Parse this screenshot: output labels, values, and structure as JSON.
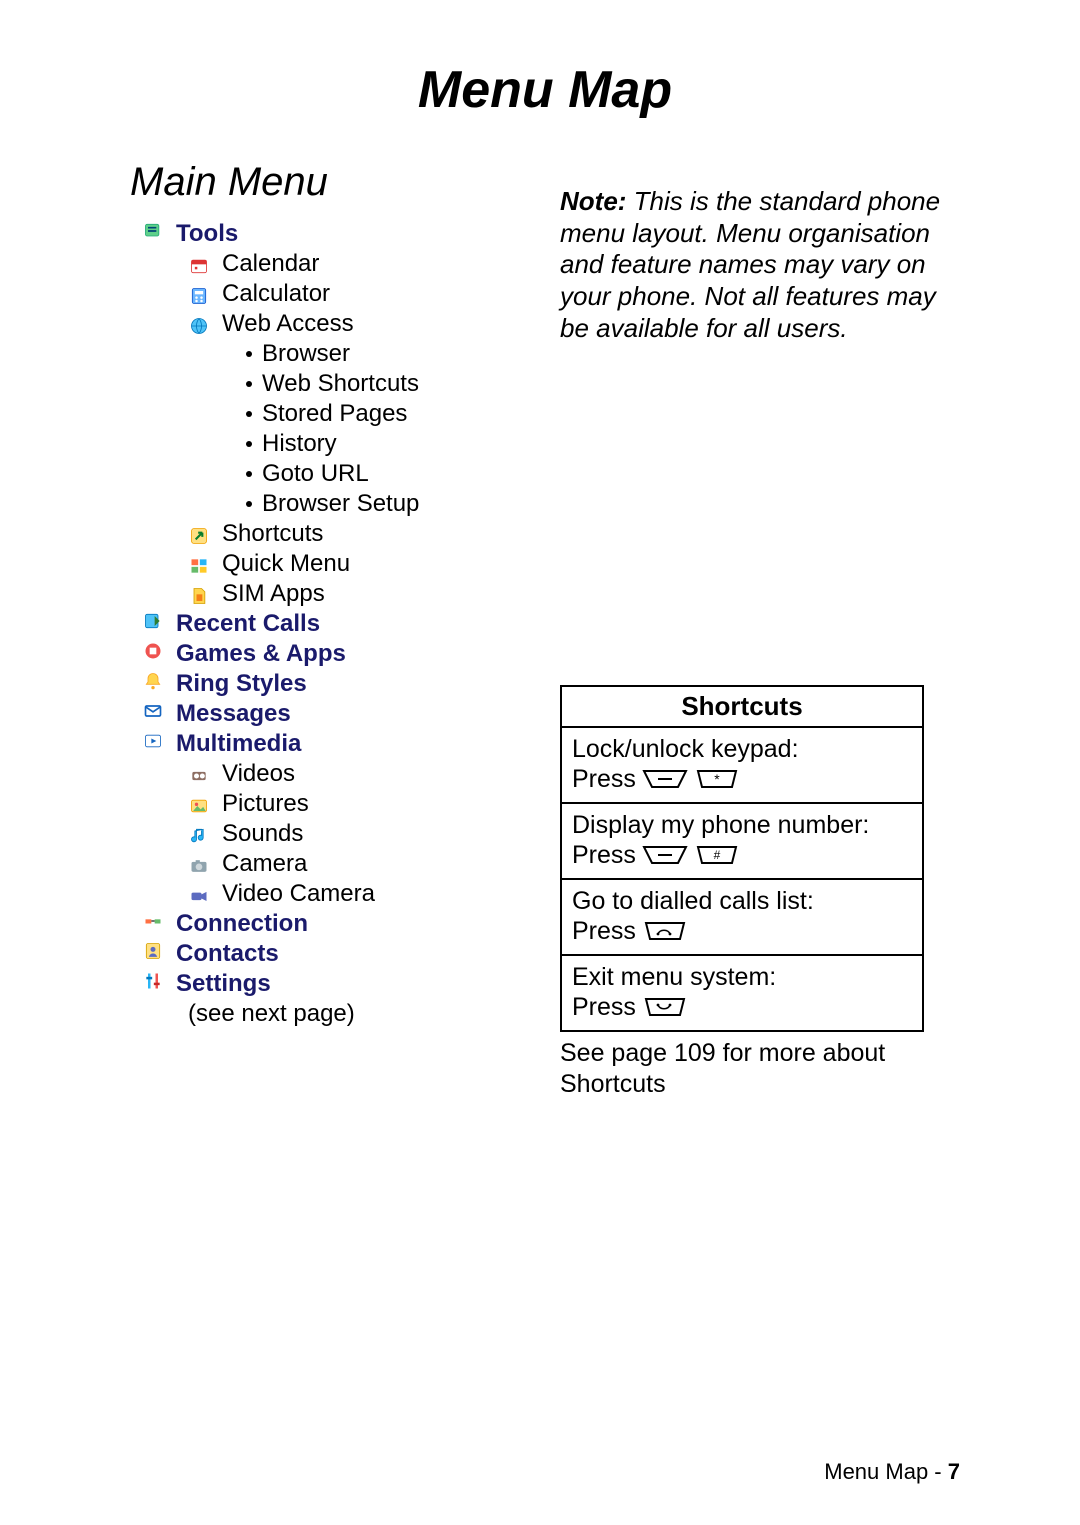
{
  "title": "Menu Map",
  "main_menu_heading": "Main Menu",
  "note": {
    "label": "Note:",
    "body": " This is the standard phone menu layout. Menu organisation and feature names may vary on your phone. Not all features may be available for all users."
  },
  "categories": [
    {
      "name": "Tools",
      "icon": "tools-icon",
      "children": [
        {
          "name": "Calendar",
          "icon": "calendar-icon"
        },
        {
          "name": "Calculator",
          "icon": "calculator-icon"
        },
        {
          "name": "Web Access",
          "icon": "web-icon",
          "children": [
            {
              "name": "Browser"
            },
            {
              "name": "Web Shortcuts"
            },
            {
              "name": "Stored Pages"
            },
            {
              "name": "History"
            },
            {
              "name": "Goto URL"
            },
            {
              "name": "Browser Setup"
            }
          ]
        },
        {
          "name": "Shortcuts",
          "icon": "shortcut-icon"
        },
        {
          "name": "Quick Menu",
          "icon": "quickmenu-icon"
        },
        {
          "name": "SIM Apps",
          "icon": "sim-icon"
        }
      ]
    },
    {
      "name": "Recent Calls",
      "icon": "recent-calls-icon"
    },
    {
      "name": "Games & Apps",
      "icon": "games-icon"
    },
    {
      "name": "Ring Styles",
      "icon": "ring-icon"
    },
    {
      "name": "Messages",
      "icon": "messages-icon"
    },
    {
      "name": "Multimedia",
      "icon": "multimedia-icon",
      "children": [
        {
          "name": "Videos",
          "icon": "videos-icon"
        },
        {
          "name": "Pictures",
          "icon": "pictures-icon"
        },
        {
          "name": "Sounds",
          "icon": "sounds-icon"
        },
        {
          "name": "Camera",
          "icon": "camera-icon"
        },
        {
          "name": "Video Camera",
          "icon": "video-camera-icon"
        }
      ]
    },
    {
      "name": "Connection",
      "icon": "connection-icon"
    },
    {
      "name": "Contacts",
      "icon": "contacts-icon"
    },
    {
      "name": "Settings",
      "icon": "settings-icon",
      "trailing": "(see next page)"
    }
  ],
  "shortcuts": {
    "header": "Shortcuts",
    "items": [
      {
        "desc": "Lock/unlock keypad:",
        "press": "Press",
        "keys": [
          "menu",
          "star"
        ]
      },
      {
        "desc": "Display my phone number:",
        "press": "Press",
        "keys": [
          "menu",
          "hash"
        ]
      },
      {
        "desc": "Go to dialled calls list:",
        "press": "Press",
        "keys": [
          "send"
        ]
      },
      {
        "desc": "Exit menu system:",
        "press": "Press",
        "keys": [
          "end"
        ]
      }
    ],
    "footer": "See page 109 for more about Shortcuts"
  },
  "footer": {
    "label": "Menu Map - ",
    "page": "7"
  }
}
